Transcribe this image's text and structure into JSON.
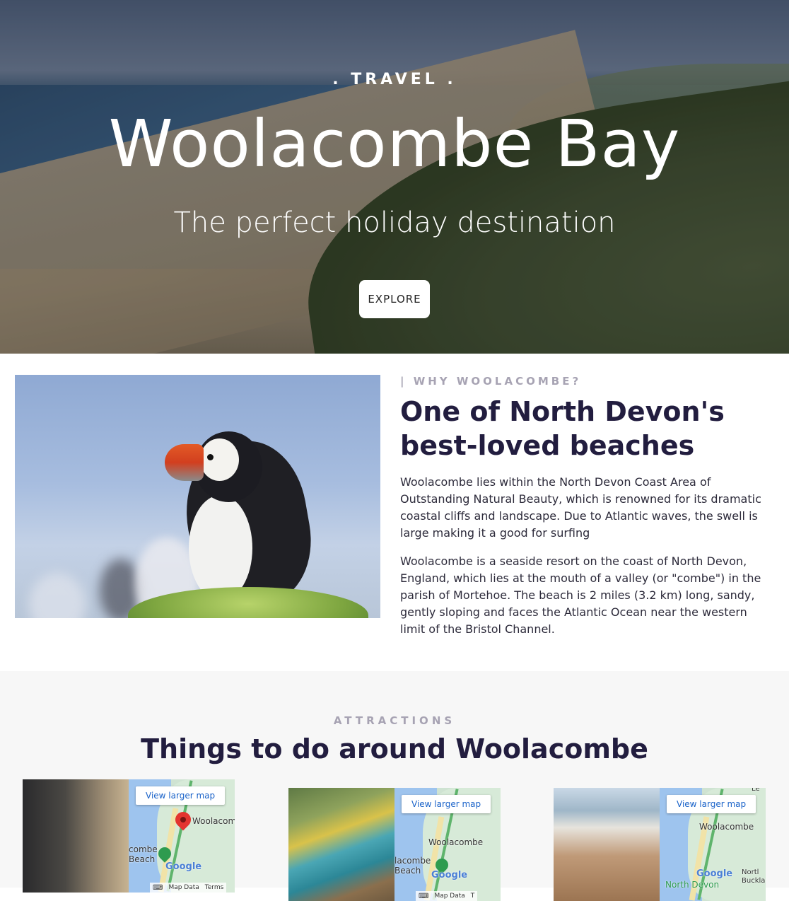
{
  "hero": {
    "eyebrow": ". TRAVEL .",
    "title": "Woolacombe Bay",
    "subtitle": "The perfect holiday destination",
    "button": "EXPLORE"
  },
  "why": {
    "eyebrow": "| WHY WOOLACOMBE?",
    "title": "One of North Devon's best-loved beaches",
    "paragraph1": "Woolacombe lies within the North Devon Coast Area of Outstanding Natural Beauty, which is renowned for its dramatic coastal cliffs and landscape. Due to Atlantic waves, the swell is large making it a good for surfing",
    "paragraph2": "Woolacombe is a seaside resort on the coast of North Devon, England, which lies at the mouth of a valley (or \"combe\") in the parish of Mortehoe. The beach is 2 miles (3.2 km) long, sandy, gently sloping and faces the Atlantic Ocean near the western limit of the Bristol Channel."
  },
  "attractions": {
    "eyebrow": "ATTRACTIONS",
    "title": "Things to do around Woolacombe",
    "cards": [
      {
        "map_button": "View larger map",
        "map_place": "Woolacom",
        "map_beach": "combe Beach",
        "map_logo": "Google",
        "map_data": "Map Data",
        "map_terms": "Terms"
      },
      {
        "map_button": "View larger map",
        "map_place": "Woolacombe",
        "map_beach": "lacombe Beach",
        "map_logo": "Google",
        "map_data": "Map Data",
        "map_terms": "T"
      },
      {
        "map_button": "View larger map",
        "map_place": "Woolacombe",
        "map_beach": "North Devon",
        "map_logo": "Google",
        "map_data": "Nortl Buckla",
        "map_terms": "Le"
      }
    ]
  },
  "colors": {
    "heading": "#221d3f",
    "eyebrow": "#a7a3b3",
    "section_bg": "#f7f7f7",
    "map_link": "#1a63c9"
  }
}
